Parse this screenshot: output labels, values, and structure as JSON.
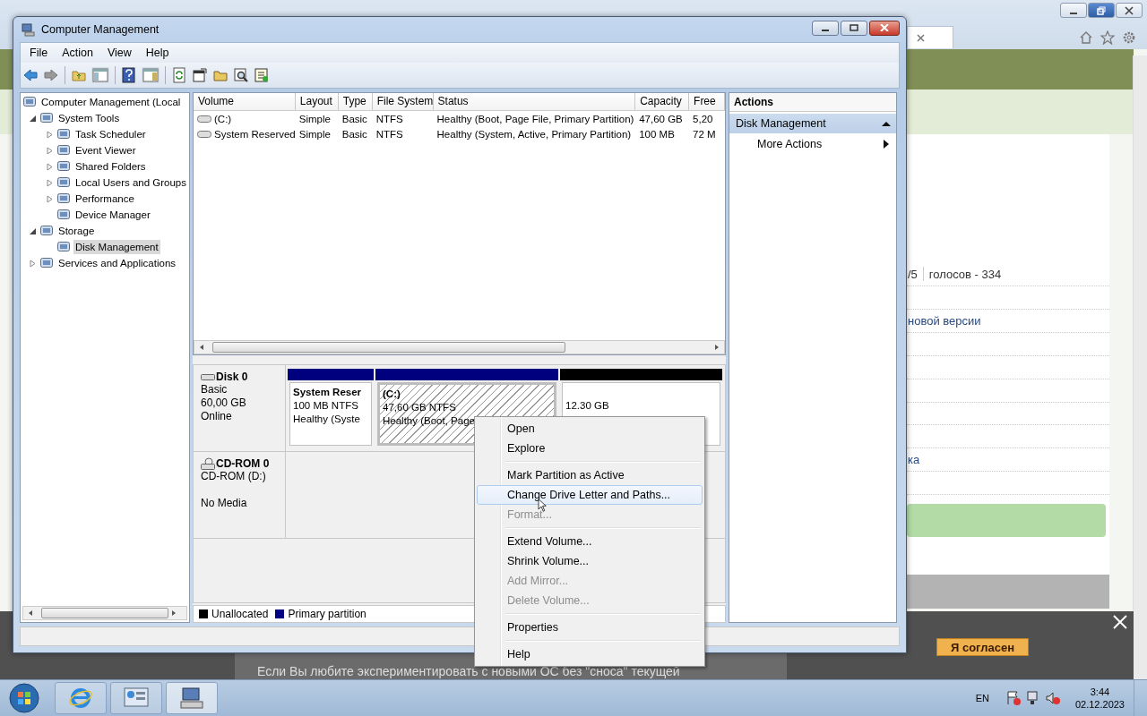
{
  "browser": {
    "rating": "/5",
    "votes": "голосов - 334",
    "lines": [
      "новой версии",
      "ка"
    ],
    "cookie": {
      "text": "Если Вы любите экспериментировать с новыми ОС без \"сноса\" текущей",
      "button": "Я согласен"
    }
  },
  "window": {
    "title": "Computer Management"
  },
  "menu": [
    "File",
    "Action",
    "View",
    "Help"
  ],
  "tree": [
    {
      "label": "Computer Management (Local",
      "selected": false,
      "children": [
        {
          "label": "System Tools",
          "expanded": true,
          "selected": false,
          "children": [
            {
              "label": "Task Scheduler",
              "expanded": false,
              "selected": false
            },
            {
              "label": "Event Viewer",
              "expanded": false,
              "selected": false
            },
            {
              "label": "Shared Folders",
              "expanded": false,
              "selected": false
            },
            {
              "label": "Local Users and Groups",
              "expanded": false,
              "selected": false
            },
            {
              "label": "Performance",
              "expanded": false,
              "selected": false
            },
            {
              "label": "Device Manager",
              "selected": false
            }
          ]
        },
        {
          "label": "Storage",
          "expanded": true,
          "selected": false,
          "children": [
            {
              "label": "Disk Management",
              "selected": true
            }
          ]
        },
        {
          "label": "Services and Applications",
          "expanded": false,
          "selected": false
        }
      ]
    }
  ],
  "volumes": {
    "columns": [
      "Volume",
      "Layout",
      "Type",
      "File System",
      "Status",
      "Capacity",
      "Free"
    ],
    "rows": [
      [
        "(C:)",
        "Simple",
        "Basic",
        "NTFS",
        "Healthy (Boot, Page File, Primary Partition)",
        "47,60 GB",
        "5,20"
      ],
      [
        "System Reserved",
        "Simple",
        "Basic",
        "NTFS",
        "Healthy (System, Active, Primary Partition)",
        "100 MB",
        "72 M"
      ]
    ]
  },
  "disks": [
    {
      "kind": "basic",
      "name": "Disk 0",
      "lines": [
        "Basic",
        "60,00 GB",
        "Online"
      ],
      "partitions": [
        {
          "kind": "primary",
          "selected": false,
          "title": "System Reser",
          "lines": [
            "100 MB NTFS",
            "Healthy (Syste"
          ]
        },
        {
          "kind": "primary",
          "selected": true,
          "title": "(C:)",
          "lines": [
            "47,60 GB NTFS",
            "Healthy (Boot, Page"
          ]
        },
        {
          "kind": "unallocated",
          "selected": false,
          "lines": [
            "12.30 GB"
          ]
        }
      ]
    },
    {
      "kind": "cdrom",
      "name": "CD-ROM 0",
      "lines": [
        "CD-ROM (D:)",
        "No Media"
      ]
    }
  ],
  "legend": [
    {
      "label": "Unallocated",
      "color": "#000000"
    },
    {
      "label": "Primary partition",
      "color": "#000080"
    }
  ],
  "actions": {
    "title": "Actions",
    "section": "Disk Management",
    "items": [
      "More Actions"
    ]
  },
  "context_menu": [
    [
      {
        "label": "Open",
        "disabled": false,
        "selected": false
      },
      {
        "label": "Explore",
        "disabled": false,
        "selected": false
      }
    ],
    [
      {
        "label": "Mark Partition as Active",
        "disabled": false,
        "selected": false
      },
      {
        "label": "Change Drive Letter and Paths...",
        "disabled": false,
        "selected": true
      },
      {
        "label": "Format...",
        "disabled": true,
        "selected": false
      }
    ],
    [
      {
        "label": "Extend Volume...",
        "disabled": false,
        "selected": false
      },
      {
        "label": "Shrink Volume...",
        "disabled": false,
        "selected": false
      },
      {
        "label": "Add Mirror...",
        "disabled": true,
        "selected": false
      },
      {
        "label": "Delete Volume...",
        "disabled": true,
        "selected": false
      }
    ],
    [
      {
        "label": "Properties",
        "disabled": false,
        "selected": false
      }
    ],
    [
      {
        "label": "Help",
        "disabled": false,
        "selected": false
      }
    ]
  ],
  "taskbar": {
    "language": "EN",
    "time": "3:44",
    "date": "02.12.2023"
  }
}
